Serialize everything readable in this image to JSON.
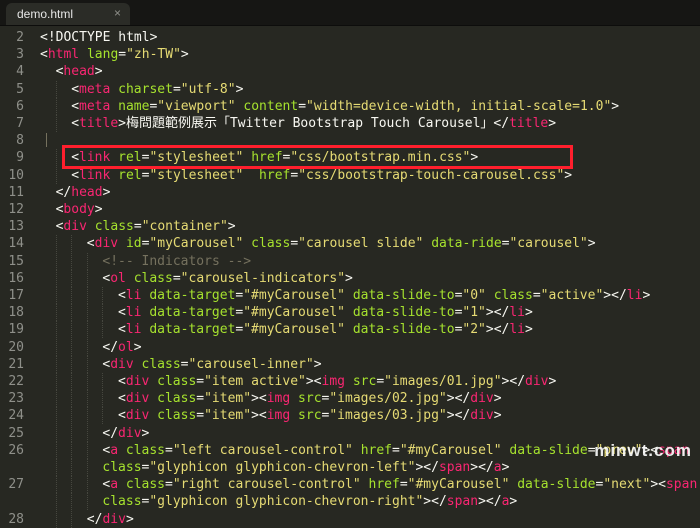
{
  "tabbar": {
    "tab_title": "demo.html",
    "close_glyph": "×"
  },
  "editor": {
    "theme": {
      "background": "#272822",
      "tag": "#f92672",
      "attr": "#a6e22e",
      "string": "#e6db74",
      "comment": "#75715e",
      "highlight": "#ff1f2d"
    },
    "lines": [
      {
        "num": "2",
        "indent": 0,
        "tokens": [
          [
            "pu",
            "<!DOCTYPE html>"
          ]
        ]
      },
      {
        "num": "3",
        "indent": 0,
        "tokens": [
          [
            "pu",
            "<"
          ],
          [
            "tg",
            "html"
          ],
          [
            "pu",
            " "
          ],
          [
            "at",
            "lang"
          ],
          [
            "pu",
            "="
          ],
          [
            "st",
            "\"zh-TW\""
          ],
          [
            "pu",
            ">"
          ]
        ]
      },
      {
        "num": "4",
        "indent": 1,
        "tokens": [
          [
            "pu",
            "<"
          ],
          [
            "tg",
            "head"
          ],
          [
            "pu",
            ">"
          ]
        ]
      },
      {
        "num": "5",
        "indent": 2,
        "tokens": [
          [
            "pu",
            "<"
          ],
          [
            "tg",
            "meta"
          ],
          [
            "pu",
            " "
          ],
          [
            "at",
            "charset"
          ],
          [
            "pu",
            "="
          ],
          [
            "st",
            "\"utf-8\""
          ],
          [
            "pu",
            ">"
          ]
        ]
      },
      {
        "num": "6",
        "indent": 2,
        "tokens": [
          [
            "pu",
            "<"
          ],
          [
            "tg",
            "meta"
          ],
          [
            "pu",
            " "
          ],
          [
            "at",
            "name"
          ],
          [
            "pu",
            "="
          ],
          [
            "st",
            "\"viewport\""
          ],
          [
            "pu",
            " "
          ],
          [
            "at",
            "content"
          ],
          [
            "pu",
            "="
          ],
          [
            "st",
            "\"width=device-width, initial-scale=1.0\""
          ],
          [
            "pu",
            ">"
          ]
        ]
      },
      {
        "num": "7",
        "indent": 2,
        "tokens": [
          [
            "pu",
            "<"
          ],
          [
            "tg",
            "title"
          ],
          [
            "pu",
            ">梅問題範例展示「Twitter Bootstrap Touch Carousel」</"
          ],
          [
            "tg",
            "title"
          ],
          [
            "pu",
            ">"
          ]
        ]
      },
      {
        "num": "8",
        "indent": 0,
        "tokens": []
      },
      {
        "num": "9",
        "indent": 2,
        "tokens": [
          [
            "pu",
            "<"
          ],
          [
            "tg",
            "link"
          ],
          [
            "pu",
            " "
          ],
          [
            "at",
            "rel"
          ],
          [
            "pu",
            "="
          ],
          [
            "st",
            "\"stylesheet\""
          ],
          [
            "pu",
            " "
          ],
          [
            "at",
            "href"
          ],
          [
            "pu",
            "="
          ],
          [
            "st",
            "\"css/bootstrap.min.css\""
          ],
          [
            "pu",
            ">"
          ]
        ]
      },
      {
        "num": "10",
        "indent": 2,
        "tokens": [
          [
            "pu",
            "<"
          ],
          [
            "tg",
            "link"
          ],
          [
            "pu",
            " "
          ],
          [
            "at",
            "rel"
          ],
          [
            "pu",
            "="
          ],
          [
            "st",
            "\"stylesheet\""
          ],
          [
            "pu",
            "  "
          ],
          [
            "at",
            "href"
          ],
          [
            "pu",
            "="
          ],
          [
            "st",
            "\"css/bootstrap-touch-carousel.css\""
          ],
          [
            "pu",
            ">"
          ]
        ]
      },
      {
        "num": "11",
        "indent": 1,
        "tokens": [
          [
            "pu",
            "</"
          ],
          [
            "tg",
            "head"
          ],
          [
            "pu",
            ">"
          ]
        ]
      },
      {
        "num": "12",
        "indent": 1,
        "tokens": [
          [
            "pu",
            "<"
          ],
          [
            "tg",
            "body"
          ],
          [
            "pu",
            ">"
          ]
        ]
      },
      {
        "num": "13",
        "indent": 1,
        "tokens": [
          [
            "pu",
            "<"
          ],
          [
            "tg",
            "div"
          ],
          [
            "pu",
            " "
          ],
          [
            "at",
            "class"
          ],
          [
            "pu",
            "="
          ],
          [
            "st",
            "\"container\""
          ],
          [
            "pu",
            ">"
          ]
        ]
      },
      {
        "num": "14",
        "indent": 3,
        "tokens": [
          [
            "pu",
            "<"
          ],
          [
            "tg",
            "div"
          ],
          [
            "pu",
            " "
          ],
          [
            "at",
            "id"
          ],
          [
            "pu",
            "="
          ],
          [
            "st",
            "\"myCarousel\""
          ],
          [
            "pu",
            " "
          ],
          [
            "at",
            "class"
          ],
          [
            "pu",
            "="
          ],
          [
            "st",
            "\"carousel slide\""
          ],
          [
            "pu",
            " "
          ],
          [
            "at",
            "data-ride"
          ],
          [
            "pu",
            "="
          ],
          [
            "st",
            "\"carousel\""
          ],
          [
            "pu",
            ">"
          ]
        ]
      },
      {
        "num": "15",
        "indent": 4,
        "tokens": [
          [
            "cm",
            "<!-- Indicators -->"
          ]
        ]
      },
      {
        "num": "16",
        "indent": 4,
        "tokens": [
          [
            "pu",
            "<"
          ],
          [
            "tg",
            "ol"
          ],
          [
            "pu",
            " "
          ],
          [
            "at",
            "class"
          ],
          [
            "pu",
            "="
          ],
          [
            "st",
            "\"carousel-indicators\""
          ],
          [
            "pu",
            ">"
          ]
        ]
      },
      {
        "num": "17",
        "indent": 5,
        "tokens": [
          [
            "pu",
            "<"
          ],
          [
            "tg",
            "li"
          ],
          [
            "pu",
            " "
          ],
          [
            "at",
            "data-target"
          ],
          [
            "pu",
            "="
          ],
          [
            "st",
            "\"#myCarousel\""
          ],
          [
            "pu",
            " "
          ],
          [
            "at",
            "data-slide-to"
          ],
          [
            "pu",
            "="
          ],
          [
            "st",
            "\"0\""
          ],
          [
            "pu",
            " "
          ],
          [
            "at",
            "class"
          ],
          [
            "pu",
            "="
          ],
          [
            "st",
            "\"active\""
          ],
          [
            "pu",
            "></"
          ],
          [
            "tg",
            "li"
          ],
          [
            "pu",
            ">"
          ]
        ]
      },
      {
        "num": "18",
        "indent": 5,
        "tokens": [
          [
            "pu",
            "<"
          ],
          [
            "tg",
            "li"
          ],
          [
            "pu",
            " "
          ],
          [
            "at",
            "data-target"
          ],
          [
            "pu",
            "="
          ],
          [
            "st",
            "\"#myCarousel\""
          ],
          [
            "pu",
            " "
          ],
          [
            "at",
            "data-slide-to"
          ],
          [
            "pu",
            "="
          ],
          [
            "st",
            "\"1\""
          ],
          [
            "pu",
            "></"
          ],
          [
            "tg",
            "li"
          ],
          [
            "pu",
            ">"
          ]
        ]
      },
      {
        "num": "19",
        "indent": 5,
        "tokens": [
          [
            "pu",
            "<"
          ],
          [
            "tg",
            "li"
          ],
          [
            "pu",
            " "
          ],
          [
            "at",
            "data-target"
          ],
          [
            "pu",
            "="
          ],
          [
            "st",
            "\"#myCarousel\""
          ],
          [
            "pu",
            " "
          ],
          [
            "at",
            "data-slide-to"
          ],
          [
            "pu",
            "="
          ],
          [
            "st",
            "\"2\""
          ],
          [
            "pu",
            "></"
          ],
          [
            "tg",
            "li"
          ],
          [
            "pu",
            ">"
          ]
        ]
      },
      {
        "num": "20",
        "indent": 4,
        "tokens": [
          [
            "pu",
            "</"
          ],
          [
            "tg",
            "ol"
          ],
          [
            "pu",
            ">"
          ]
        ]
      },
      {
        "num": "21",
        "indent": 4,
        "tokens": [
          [
            "pu",
            "<"
          ],
          [
            "tg",
            "div"
          ],
          [
            "pu",
            " "
          ],
          [
            "at",
            "class"
          ],
          [
            "pu",
            "="
          ],
          [
            "st",
            "\"carousel-inner\""
          ],
          [
            "pu",
            ">"
          ]
        ]
      },
      {
        "num": "22",
        "indent": 5,
        "tokens": [
          [
            "pu",
            "<"
          ],
          [
            "tg",
            "div"
          ],
          [
            "pu",
            " "
          ],
          [
            "at",
            "class"
          ],
          [
            "pu",
            "="
          ],
          [
            "st",
            "\"item active\""
          ],
          [
            "pu",
            "><"
          ],
          [
            "tg",
            "img"
          ],
          [
            "pu",
            " "
          ],
          [
            "at",
            "src"
          ],
          [
            "pu",
            "="
          ],
          [
            "st",
            "\"images/01.jpg\""
          ],
          [
            "pu",
            "></"
          ],
          [
            "tg",
            "div"
          ],
          [
            "pu",
            ">"
          ]
        ]
      },
      {
        "num": "23",
        "indent": 5,
        "tokens": [
          [
            "pu",
            "<"
          ],
          [
            "tg",
            "div"
          ],
          [
            "pu",
            " "
          ],
          [
            "at",
            "class"
          ],
          [
            "pu",
            "="
          ],
          [
            "st",
            "\"item\""
          ],
          [
            "pu",
            "><"
          ],
          [
            "tg",
            "img"
          ],
          [
            "pu",
            " "
          ],
          [
            "at",
            "src"
          ],
          [
            "pu",
            "="
          ],
          [
            "st",
            "\"images/02.jpg\""
          ],
          [
            "pu",
            "></"
          ],
          [
            "tg",
            "div"
          ],
          [
            "pu",
            ">"
          ]
        ]
      },
      {
        "num": "24",
        "indent": 5,
        "tokens": [
          [
            "pu",
            "<"
          ],
          [
            "tg",
            "div"
          ],
          [
            "pu",
            " "
          ],
          [
            "at",
            "class"
          ],
          [
            "pu",
            "="
          ],
          [
            "st",
            "\"item\""
          ],
          [
            "pu",
            "><"
          ],
          [
            "tg",
            "img"
          ],
          [
            "pu",
            " "
          ],
          [
            "at",
            "src"
          ],
          [
            "pu",
            "="
          ],
          [
            "st",
            "\"images/03.jpg\""
          ],
          [
            "pu",
            "></"
          ],
          [
            "tg",
            "div"
          ],
          [
            "pu",
            ">"
          ]
        ]
      },
      {
        "num": "25",
        "indent": 4,
        "tokens": [
          [
            "pu",
            "</"
          ],
          [
            "tg",
            "div"
          ],
          [
            "pu",
            ">"
          ]
        ]
      },
      {
        "num": "26",
        "indent": 4,
        "tokens": [
          [
            "pu",
            "<"
          ],
          [
            "tg",
            "a"
          ],
          [
            "pu",
            " "
          ],
          [
            "at",
            "class"
          ],
          [
            "pu",
            "="
          ],
          [
            "st",
            "\"left carousel-control\""
          ],
          [
            "pu",
            " "
          ],
          [
            "at",
            "href"
          ],
          [
            "pu",
            "="
          ],
          [
            "st",
            "\"#myCarousel\""
          ],
          [
            "pu",
            " "
          ],
          [
            "at",
            "data-slide"
          ],
          [
            "pu",
            "="
          ],
          [
            "st",
            "\"prev\""
          ],
          [
            "pu",
            "><"
          ],
          [
            "tg",
            "span"
          ]
        ]
      },
      {
        "num": "",
        "indent": 4,
        "tokens": [
          [
            "at",
            "class"
          ],
          [
            "pu",
            "="
          ],
          [
            "st",
            "\"glyphicon glyphicon-chevron-left\""
          ],
          [
            "pu",
            "></"
          ],
          [
            "tg",
            "span"
          ],
          [
            "pu",
            "></"
          ],
          [
            "tg",
            "a"
          ],
          [
            "pu",
            ">"
          ]
        ]
      },
      {
        "num": "27",
        "indent": 4,
        "tokens": [
          [
            "pu",
            "<"
          ],
          [
            "tg",
            "a"
          ],
          [
            "pu",
            " "
          ],
          [
            "at",
            "class"
          ],
          [
            "pu",
            "="
          ],
          [
            "st",
            "\"right carousel-control\""
          ],
          [
            "pu",
            " "
          ],
          [
            "at",
            "href"
          ],
          [
            "pu",
            "="
          ],
          [
            "st",
            "\"#myCarousel\""
          ],
          [
            "pu",
            " "
          ],
          [
            "at",
            "data-slide"
          ],
          [
            "pu",
            "="
          ],
          [
            "st",
            "\"next\""
          ],
          [
            "pu",
            "><"
          ],
          [
            "tg",
            "span"
          ]
        ]
      },
      {
        "num": "",
        "indent": 4,
        "tokens": [
          [
            "at",
            "class"
          ],
          [
            "pu",
            "="
          ],
          [
            "st",
            "\"glyphicon glyphicon-chevron-right\""
          ],
          [
            "pu",
            "></"
          ],
          [
            "tg",
            "span"
          ],
          [
            "pu",
            "></"
          ],
          [
            "tg",
            "a"
          ],
          [
            "pu",
            ">"
          ]
        ]
      },
      {
        "num": "28",
        "indent": 3,
        "tokens": [
          [
            "pu",
            "</"
          ],
          [
            "tg",
            "div"
          ],
          [
            "pu",
            ">"
          ]
        ]
      }
    ]
  },
  "watermark": "minwt.com"
}
